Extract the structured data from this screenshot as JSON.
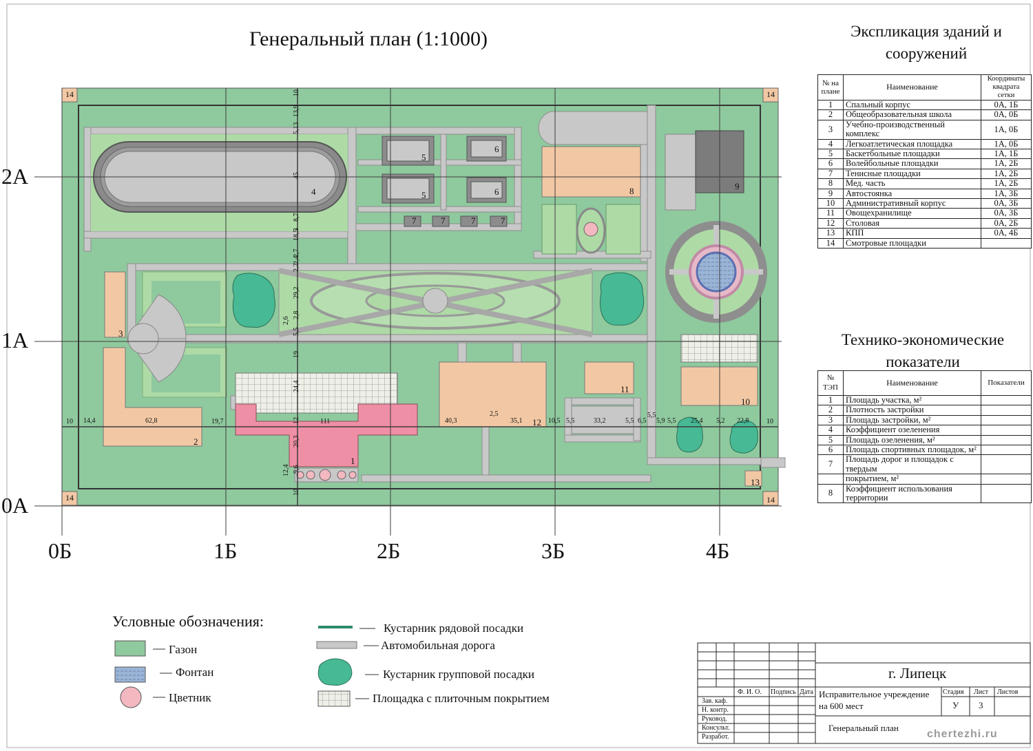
{
  "plan": {
    "title": "Генеральный план (1:1000)",
    "row_axes": [
      "2А",
      "1А",
      "0А"
    ],
    "col_axes": [
      "0Б",
      "1Б",
      "2Б",
      "3Б",
      "4Б"
    ],
    "building_numbers": [
      "1",
      "2",
      "3",
      "4",
      "5",
      "6",
      "7",
      "8",
      "9",
      "10",
      "11",
      "12",
      "13",
      "14"
    ],
    "vertical_dims": [
      "10",
      "13,9",
      "5,13",
      "45",
      "8,7",
      "3",
      "18,5",
      "2,7",
      "2,4",
      "2,2",
      "29,2",
      "2,6",
      "2,8",
      "5,5",
      "19",
      "24,4",
      "12",
      "20,3",
      "9,6",
      "12,4",
      "10"
    ],
    "horizontal_dims": [
      "10",
      "14,4",
      "62,8",
      "19,7",
      "111",
      "40,3",
      "2,5",
      "35,1",
      "10,5",
      "5,5",
      "33,2",
      "5,5",
      "6,5",
      "5,5",
      "5,9",
      "5,5",
      "25,4",
      "5,2",
      "22,8",
      "10"
    ],
    "colors": {
      "lawn": "#8fc99e",
      "lawn_light": "#aedaa6",
      "road": "#c8c8c8",
      "building": "#f2c8a4",
      "main_building": "#ee8fa5",
      "tile": "#eef0e8",
      "water": "#9ab4d6",
      "shrub": "#47b995",
      "grid_line": "#444444"
    }
  },
  "explication": {
    "title_line1": "Экспликация зданий и",
    "title_line2": "сооружений",
    "headers": [
      "№ на плане",
      "Наименование",
      "Координаты квадрата сетки"
    ],
    "rows": [
      [
        "1",
        "Спальный корпус",
        "0А, 1Б"
      ],
      [
        "2",
        "Общеобразовательная школа",
        "0А, 0Б"
      ],
      [
        "3",
        "Учебно-производственный комплекс",
        "1А, 0Б"
      ],
      [
        "4",
        "Легкоатлетическая площадка",
        "1А, 0Б"
      ],
      [
        "5",
        "Баскетбольные площадки",
        "1А, 1Б"
      ],
      [
        "6",
        "Волейбольные площадки",
        "1А, 2Б"
      ],
      [
        "7",
        "Тенисные площадки",
        "1А, 2Б"
      ],
      [
        "8",
        "Мед. часть",
        "1А, 2Б"
      ],
      [
        "9",
        "Автостоянка",
        "1А, 3Б"
      ],
      [
        "10",
        "Административный корпус",
        "0А, 3Б"
      ],
      [
        "11",
        "Овощехранилище",
        "0А, 3Б"
      ],
      [
        "12",
        "Столовая",
        "0А, 2Б"
      ],
      [
        "13",
        "КПП",
        "0А, 4Б"
      ],
      [
        "14",
        "Смотровые площадки",
        ""
      ]
    ]
  },
  "tep": {
    "title_line1": "Технико-экономические",
    "title_line2": "показатели",
    "headers": [
      "№ ТЭП",
      "Наименование",
      "Показатели"
    ],
    "rows": [
      [
        "1",
        "Площадь участка, м²",
        ""
      ],
      [
        "2",
        "Плотность застройки",
        ""
      ],
      [
        "3",
        "Площадь застройки, м²",
        ""
      ],
      [
        "4",
        "Коэффициент озеленения",
        ""
      ],
      [
        "5",
        "Площадь озеленения, м²",
        ""
      ],
      [
        "6",
        "Площадь спортивных площадок, м²",
        ""
      ],
      [
        "7",
        "Площадь дорог и площадок с твердым",
        ""
      ],
      [
        "",
        "покрытием, м²",
        ""
      ],
      [
        "8",
        "Коэффициент использования территории",
        ""
      ]
    ]
  },
  "legend": {
    "title": "Условные обозначения:",
    "items": [
      {
        "label": "Газон",
        "icon": "lawn-swatch"
      },
      {
        "label": "Фонтан",
        "icon": "fountain-swatch"
      },
      {
        "label": "Цветник",
        "icon": "flowerbed-circle"
      },
      {
        "label": "Кустарник рядовой посадки",
        "icon": "row-shrub-line"
      },
      {
        "label": "Автомобильная дорога",
        "icon": "road-line"
      },
      {
        "label": "Кустарник групповой посадки",
        "icon": "group-shrub-icon"
      },
      {
        "label": "Площадка с плиточным покрытием",
        "icon": "tile-swatch"
      }
    ]
  },
  "stamp": {
    "city": "г. Липецк",
    "project_line1": "Исправительное учреждение",
    "project_line2": "на 600 мест",
    "sheet_title": "Генеральный план",
    "col_fio": "Ф. И. О.",
    "col_sign": "Подпись",
    "col_date": "Дата",
    "col_stage": "Стадия",
    "col_sheet": "Лист",
    "col_sheets": "Листов",
    "stage_value": "У",
    "sheet_value": "3",
    "roles": [
      "Зав. каф.",
      "Н. контр.",
      "Руковод.",
      "Консульт.",
      "Разработ."
    ]
  },
  "watermark": "chertezhi.ru"
}
